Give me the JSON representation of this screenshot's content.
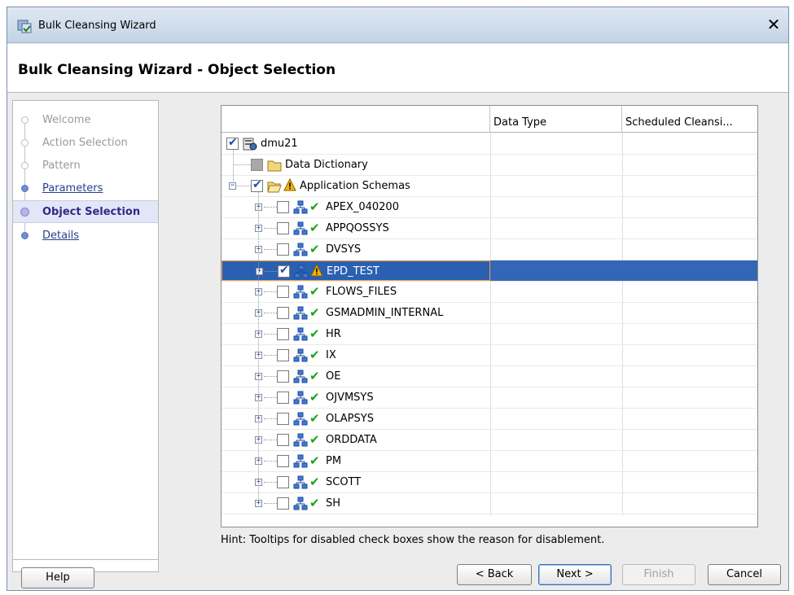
{
  "window": {
    "title": "Bulk Cleansing Wizard",
    "close_glyph": "✕"
  },
  "header": {
    "title": "Bulk Cleansing Wizard - Object Selection"
  },
  "nav": {
    "items": [
      {
        "label": "Welcome",
        "state": "done"
      },
      {
        "label": "Action Selection",
        "state": "done"
      },
      {
        "label": "Pattern",
        "state": "done"
      },
      {
        "label": "Parameters",
        "state": "link"
      },
      {
        "label": "Object Selection",
        "state": "current"
      },
      {
        "label": "Details",
        "state": "link"
      }
    ]
  },
  "table": {
    "columns": [
      "",
      "Data Type",
      "Scheduled Cleansi..."
    ],
    "rows": [
      {
        "label": "dmu21",
        "checked": true
      },
      {
        "label": "Data Dictionary",
        "checked": false,
        "disabled": true
      },
      {
        "label": "Application Schemas",
        "checked": true,
        "warning": true
      },
      {
        "label": "APEX_040200",
        "checked": false
      },
      {
        "label": "APPQOSSYS",
        "checked": false
      },
      {
        "label": "DVSYS",
        "checked": false
      },
      {
        "label": "EPD_TEST",
        "checked": true,
        "warning": true,
        "selected": true
      },
      {
        "label": "FLOWS_FILES",
        "checked": false
      },
      {
        "label": "GSMADMIN_INTERNAL",
        "checked": false
      },
      {
        "label": "HR",
        "checked": false
      },
      {
        "label": "IX",
        "checked": false
      },
      {
        "label": "OE",
        "checked": false
      },
      {
        "label": "OJVMSYS",
        "checked": false
      },
      {
        "label": "OLAPSYS",
        "checked": false
      },
      {
        "label": "ORDDATA",
        "checked": false
      },
      {
        "label": "PM",
        "checked": false
      },
      {
        "label": "SCOTT",
        "checked": false
      },
      {
        "label": "SH",
        "checked": false
      }
    ]
  },
  "hint": "Hint: Tooltips for disabled check boxes show the reason for disablement.",
  "buttons": {
    "help": "Help",
    "back": "< Back",
    "next": "Next >",
    "finish": "Finish",
    "cancel": "Cancel"
  },
  "colors": {
    "selection": "#3466b7",
    "nav_current": "#2e2a86",
    "nav_link": "#273f8d",
    "ok": "#19a31c",
    "warning": "#f5b400"
  }
}
